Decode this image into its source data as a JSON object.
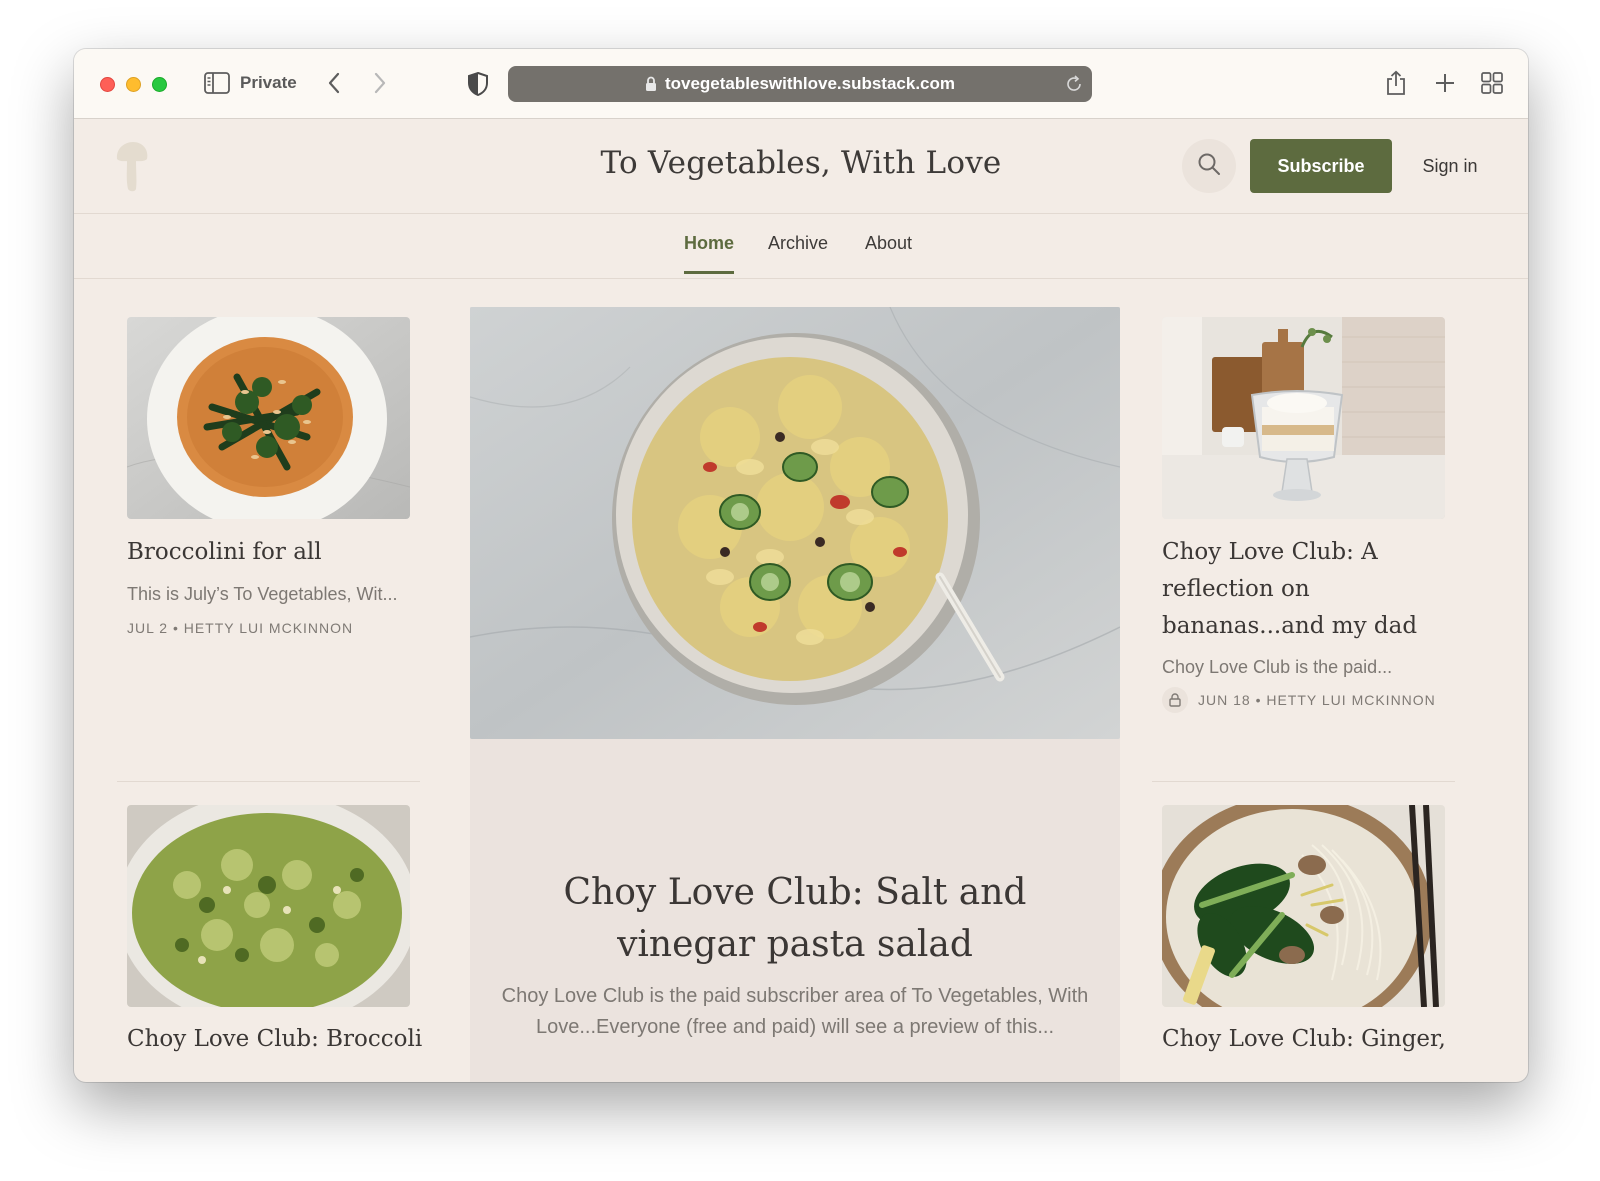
{
  "browser": {
    "private_label": "Private",
    "url": "tovegetableswithlove.substack.com"
  },
  "site": {
    "title": "To Vegetables, With Love",
    "subscribe_label": "Subscribe",
    "signin_label": "Sign in",
    "accent_color": "#5d6b3f"
  },
  "nav": {
    "tabs": [
      {
        "label": "Home",
        "active": true
      },
      {
        "label": "Archive",
        "active": false
      },
      {
        "label": "About",
        "active": false
      }
    ]
  },
  "posts": {
    "left_top": {
      "title": "Broccolini for all",
      "excerpt": "This is July’s To Vegetables, Wit...",
      "meta": "JUL 2 • HETTY LUI MCKINNON"
    },
    "featured": {
      "title": "Choy Love Club: Salt and vinegar pasta salad",
      "excerpt": "Choy Love Club is the paid subscriber area of To Vegetables, With Love...Everyone (free and paid) will see a preview of this..."
    },
    "right_top": {
      "title": "Choy Love Club: A reflection on bananas...and my dad",
      "excerpt": "Choy Love Club is the paid...",
      "meta": "JUN 18 • HETTY LUI MCKINNON",
      "locked": true
    },
    "left_bottom": {
      "title": "Choy Love Club: Broccoli"
    },
    "right_bottom": {
      "title": "Choy Love Club: Ginger,"
    }
  }
}
